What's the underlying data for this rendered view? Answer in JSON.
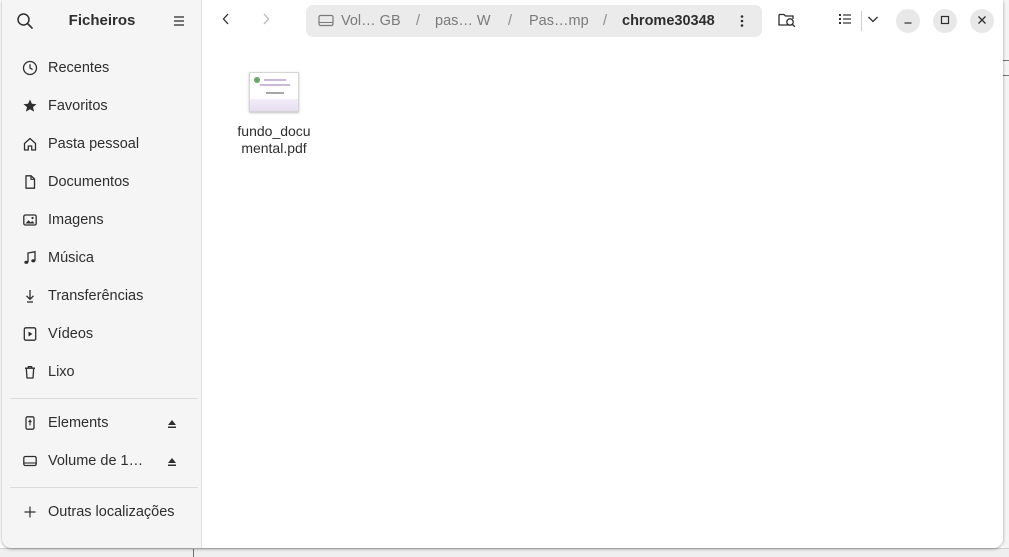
{
  "sidebar": {
    "title": "Ficheiros",
    "places": [
      {
        "label": "Recentes",
        "icon": "clock-icon"
      },
      {
        "label": "Favoritos",
        "icon": "star-icon"
      },
      {
        "label": "Pasta pessoal",
        "icon": "home-icon"
      },
      {
        "label": "Documentos",
        "icon": "document-icon"
      },
      {
        "label": "Imagens",
        "icon": "image-icon"
      },
      {
        "label": "Música",
        "icon": "music-icon"
      },
      {
        "label": "Transferências",
        "icon": "download-icon"
      },
      {
        "label": "Vídeos",
        "icon": "video-icon"
      },
      {
        "label": "Lixo",
        "icon": "trash-icon"
      }
    ],
    "devices": [
      {
        "label": "Elements",
        "icon": "usb-drive-icon"
      },
      {
        "label": "Volume de 1…",
        "icon": "drive-icon"
      }
    ],
    "other_locations": "Outras localizações"
  },
  "pathbar": {
    "crumbs": [
      "Vol… GB",
      "pas… W",
      "Pas…mp",
      "chrome30348"
    ],
    "separator": "/"
  },
  "files": [
    {
      "name": "fundo_documental.pdf",
      "line1": "fundo_docu",
      "line2": "mental.pdf"
    }
  ],
  "colors": {
    "sidebar_bg": "#f5f5f5",
    "pathbar_bg": "#ebebeb",
    "text": "#2e2e2e"
  }
}
